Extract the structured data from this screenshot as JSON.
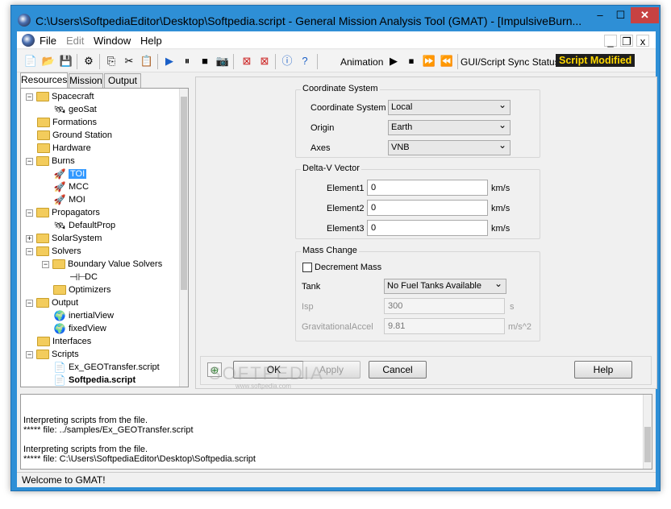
{
  "window": {
    "title": "C:\\Users\\SoftpediaEditor\\Desktop\\Softpedia.script - General Mission Analysis Tool (GMAT) - [ImpulsiveBurn..."
  },
  "controls": {
    "minimize": "–",
    "maximize": "☐",
    "close": "✕"
  },
  "menu": [
    "File",
    "Edit",
    "Window",
    "Help"
  ],
  "mdi": {
    "minimize": "_",
    "restore": "❐",
    "close": "x"
  },
  "toolbar": {
    "animation_label": "Animation",
    "sync_label": "GUI/Script Sync Status:",
    "sync_status": "Script Modified"
  },
  "tabs": [
    "Resources",
    "Mission",
    "Output"
  ],
  "tree": {
    "spacecraft": "Spacecraft",
    "geosat": "geoSat",
    "formations": "Formations",
    "ground_station": "Ground Station",
    "hardware": "Hardware",
    "burns": "Burns",
    "toi": "TOI",
    "mcc": "MCC",
    "moi": "MOI",
    "propagators": "Propagators",
    "defaultprop": "DefaultProp",
    "solarsystem": "SolarSystem",
    "solvers": "Solvers",
    "bvs": "Boundary Value Solvers",
    "dc": "DC",
    "optimizers": "Optimizers",
    "output": "Output",
    "inertialview": "inertialView",
    "fixedview": "fixedView",
    "interfaces": "Interfaces",
    "scripts": "Scripts",
    "script1": "Ex_GEOTransfer.script",
    "script2": "Softpedia.script"
  },
  "coord": {
    "group": "Coordinate System",
    "cs_label": "Coordinate System",
    "cs_value": "Local",
    "origin_label": "Origin",
    "origin_value": "Earth",
    "axes_label": "Axes",
    "axes_value": "VNB"
  },
  "deltav": {
    "group": "Delta-V Vector",
    "e1_label": "Element1",
    "e1_value": "0",
    "e2_label": "Element2",
    "e2_value": "0",
    "e3_label": "Element3",
    "e3_value": "0",
    "unit": "km/s"
  },
  "mass": {
    "group": "Mass Change",
    "decrement_label": "Decrement Mass",
    "tank_label": "Tank",
    "tank_value": "No Fuel Tanks Available",
    "isp_label": "Isp",
    "isp_value": "300",
    "isp_unit": "s",
    "grav_label": "GravitationalAccel",
    "grav_value": "9.81",
    "grav_unit": "m/s^2"
  },
  "buttons": {
    "ok": "OK",
    "apply": "Apply",
    "cancel": "Cancel",
    "help": "Help"
  },
  "console": [
    "Interpreting scripts from the file.",
    "***** file: ../samples/Ex_GEOTransfer.script",
    "",
    "Interpreting scripts from the file.",
    "***** file: C:\\Users\\SoftpediaEditor\\Desktop\\Softpedia.script"
  ],
  "statusbar": "Welcome to GMAT!",
  "watermark": {
    "main": "SOFTPEDIA",
    "sub": "www.softpedia.com"
  }
}
